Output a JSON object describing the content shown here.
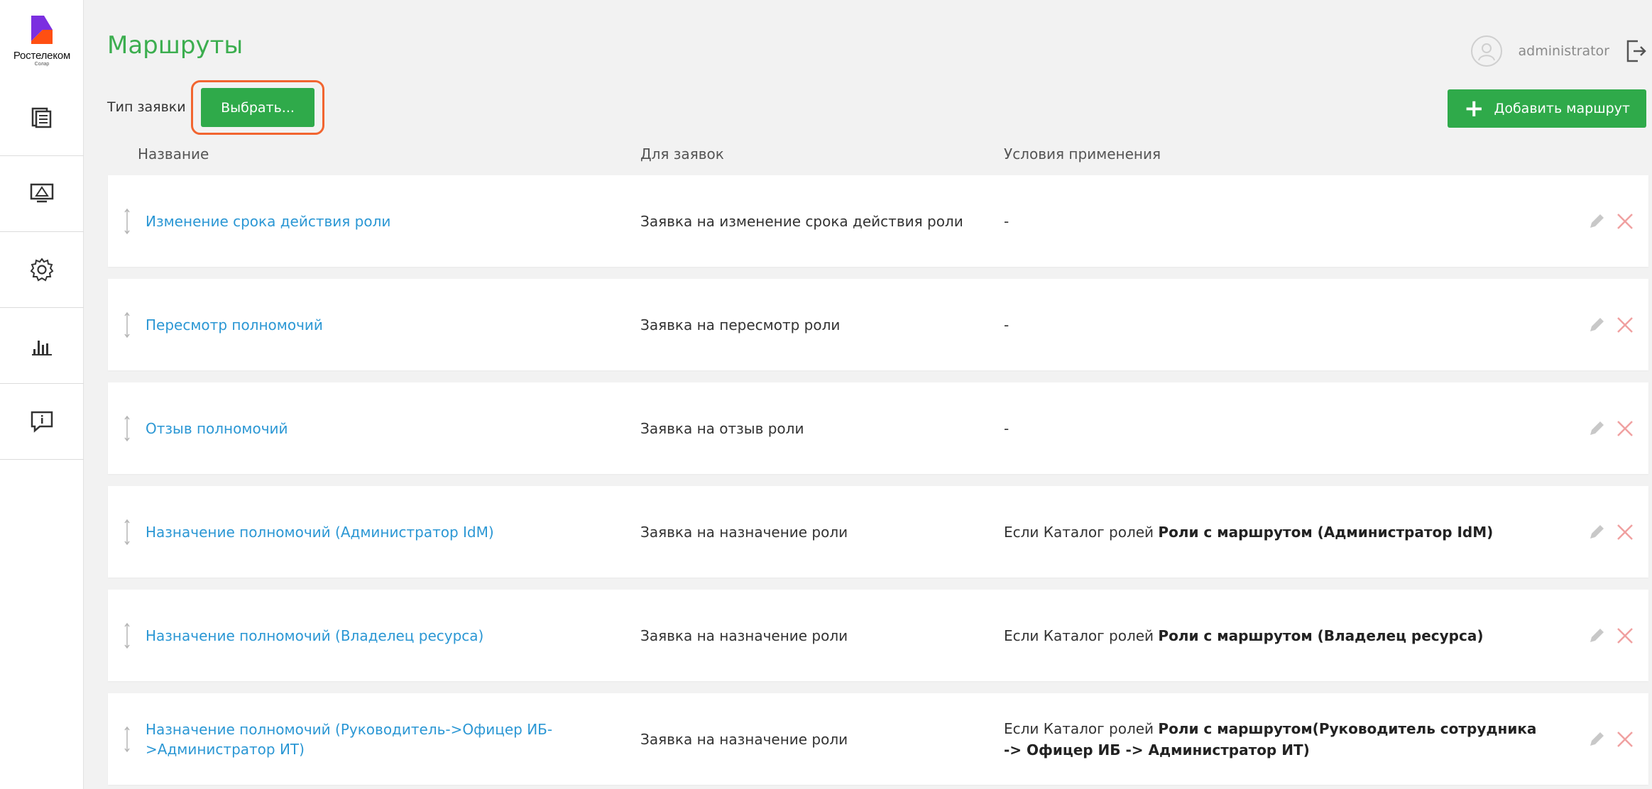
{
  "brand": {
    "name": "Ростелеком",
    "sub": "Солар"
  },
  "sidebar": {
    "items": [
      {
        "icon": "documents-icon"
      },
      {
        "icon": "monitor-icon"
      },
      {
        "icon": "gear-icon"
      },
      {
        "icon": "bar-chart-icon"
      },
      {
        "icon": "feedback-icon"
      }
    ]
  },
  "header": {
    "title": "Маршруты",
    "username": "administrator"
  },
  "filter": {
    "label": "Тип заявки",
    "select_label": "Выбрать...",
    "highlight_color": "#f26530"
  },
  "toolbar": {
    "add_label": "Добавить маршрут"
  },
  "table": {
    "columns": [
      "Название",
      "Для заявок",
      "Условия применения"
    ],
    "rows": [
      {
        "name": "Изменение срока действия роли",
        "request_type": "Заявка на изменение срока действия роли",
        "condition_prefix": "-",
        "condition_bold": ""
      },
      {
        "name": "Пересмотр полномочий",
        "request_type": "Заявка на пересмотр роли",
        "condition_prefix": "-",
        "condition_bold": ""
      },
      {
        "name": "Отзыв полномочий",
        "request_type": "Заявка на отзыв роли",
        "condition_prefix": "-",
        "condition_bold": ""
      },
      {
        "name": "Назначение полномочий (Администратор IdM)",
        "request_type": "Заявка на назначение роли",
        "condition_prefix": "Если Каталог ролей ",
        "condition_bold": "Роли с маршрутом (Администратор IdM)"
      },
      {
        "name": "Назначение полномочий (Владелец ресурса)",
        "request_type": "Заявка на назначение роли",
        "condition_prefix": "Если Каталог ролей ",
        "condition_bold": "Роли с маршрутом (Владелец ресурса)"
      },
      {
        "name": "Назначение полномочий (Руководитель->Офицер ИБ- >Администратор ИТ)",
        "request_type": "Заявка на назначение роли",
        "condition_prefix": "Если Каталог ролей ",
        "condition_bold": "Роли с маршрутом(Руководитель сотрудника -> Офицер ИБ -> Администратор ИТ)"
      }
    ]
  },
  "colors": {
    "accent_green": "#2faa4a",
    "title_green": "#3cae4f",
    "link_blue": "#2b97d4",
    "delete_red": "#f0a0a0",
    "edit_gray": "#c8c8c8"
  }
}
